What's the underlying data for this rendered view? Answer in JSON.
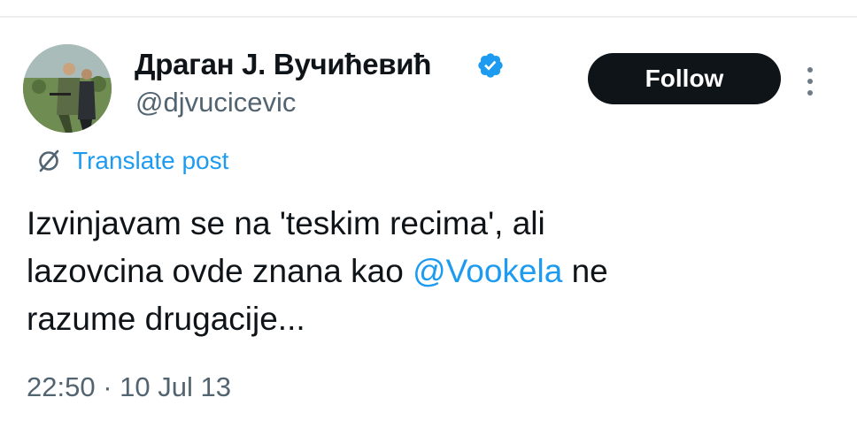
{
  "author": {
    "display_name": "Драган Ј. Вучићевић",
    "handle": "@djvucicevic",
    "verified": true,
    "avatar_icon": "profile-photo"
  },
  "actions": {
    "follow_label": "Follow",
    "more_icon": "more-vertical-icon"
  },
  "translate": {
    "icon": "translate-icon",
    "label": "Translate post"
  },
  "tweet": {
    "line1": "Izvinjavam se na 'teskim recima', ali",
    "line2_before": "lazovcina ovde znana kao ",
    "mention": "@Vookela",
    "line2_after": " ne",
    "line3": "razume drugacije..."
  },
  "meta": {
    "time": "22:50",
    "separator": " · ",
    "date": "10 Jul 13"
  },
  "colors": {
    "text": "#0f1419",
    "secondary": "#536471",
    "link": "#1d9bf0",
    "button_bg": "#0f1419",
    "verified": "#1d9bf0"
  }
}
